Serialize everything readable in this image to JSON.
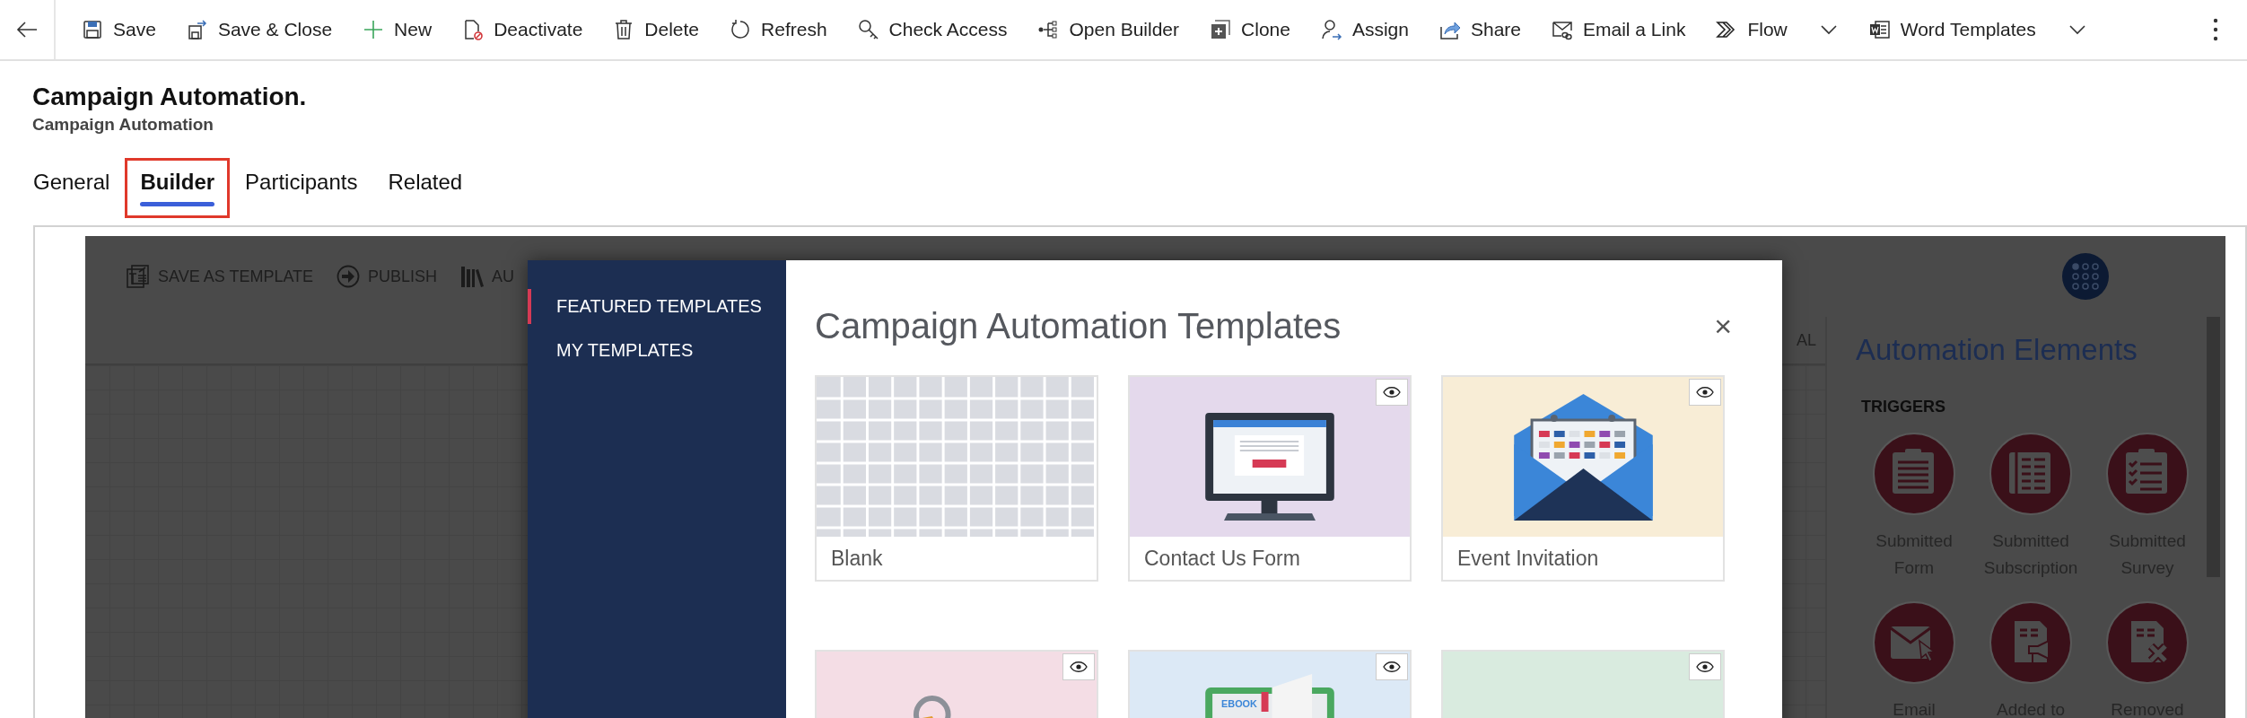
{
  "command_bar": {
    "items": [
      {
        "label": "Save",
        "dropdown": false
      },
      {
        "label": "Save & Close",
        "dropdown": false
      },
      {
        "label": "New",
        "dropdown": false
      },
      {
        "label": "Deactivate",
        "dropdown": false
      },
      {
        "label": "Delete",
        "dropdown": false
      },
      {
        "label": "Refresh",
        "dropdown": false
      },
      {
        "label": "Check Access",
        "dropdown": false
      },
      {
        "label": "Open Builder",
        "dropdown": false
      },
      {
        "label": "Clone",
        "dropdown": false
      },
      {
        "label": "Assign",
        "dropdown": false
      },
      {
        "label": "Share",
        "dropdown": false
      },
      {
        "label": "Email a Link",
        "dropdown": false
      },
      {
        "label": "Flow",
        "dropdown": true
      },
      {
        "label": "Word Templates",
        "dropdown": true
      }
    ]
  },
  "record": {
    "title": "Campaign Automation.",
    "subtitle": "Campaign Automation"
  },
  "tabs": [
    {
      "label": "General",
      "selected": false,
      "highlighted": false
    },
    {
      "label": "Builder",
      "selected": true,
      "highlighted": true
    },
    {
      "label": "Participants",
      "selected": false,
      "highlighted": false
    },
    {
      "label": "Related",
      "selected": false,
      "highlighted": false
    }
  ],
  "builder": {
    "toolbar": [
      {
        "label": "SAVE AS TEMPLATE"
      },
      {
        "label": "PUBLISH"
      },
      {
        "label": "AU"
      }
    ],
    "canvas_label": "AL",
    "panel": {
      "title": "Automation Elements",
      "section": "TRIGGERS",
      "elements": [
        {
          "label": "Submitted Form"
        },
        {
          "label": "Submitted Subscription"
        },
        {
          "label": "Submitted Survey"
        },
        {
          "label": "Email"
        },
        {
          "label": "Added to"
        },
        {
          "label": "Removed"
        }
      ]
    }
  },
  "template_dialog": {
    "nav": [
      {
        "label": "FEATURED TEMPLATES",
        "selected": true
      },
      {
        "label": "MY TEMPLATES",
        "selected": false
      }
    ],
    "title": "Campaign Automation Templates",
    "close": "×",
    "templates": [
      {
        "name": "Blank",
        "kind": "blank",
        "preview": false
      },
      {
        "name": "Contact Us Form",
        "kind": "monitor",
        "preview": true
      },
      {
        "name": "Event Invitation",
        "kind": "envelope",
        "preview": true
      },
      {
        "kind": "tag",
        "preview": true
      },
      {
        "kind": "ebook",
        "preview": true,
        "illustration_text": "EBOOK"
      },
      {
        "kind": "window",
        "preview": true
      }
    ]
  }
}
